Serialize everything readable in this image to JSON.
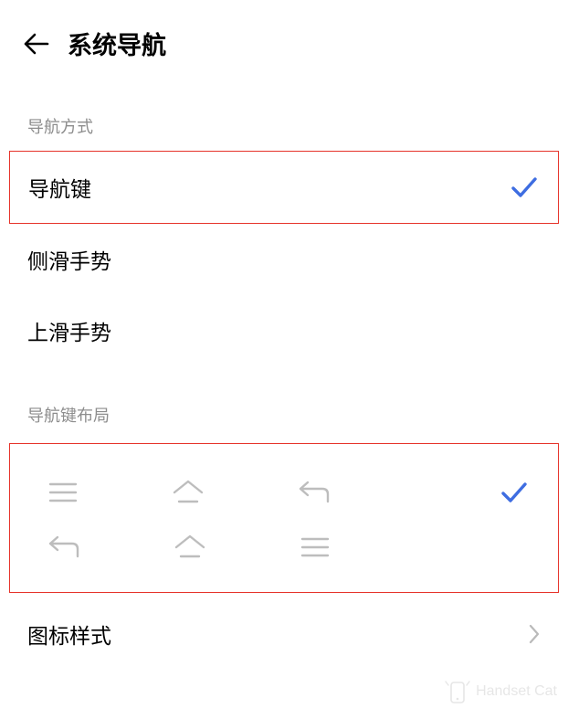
{
  "header": {
    "title": "系统导航"
  },
  "sections": {
    "nav_method_label": "导航方式",
    "nav_layout_label": "导航键布局"
  },
  "options": {
    "nav_keys": "导航键",
    "side_swipe": "侧滑手势",
    "up_swipe": "上滑手势"
  },
  "link": {
    "icon_style": "图标样式"
  },
  "colors": {
    "accent": "#3e6de1",
    "highlight_border": "#e6332a",
    "icon_gray": "#bdbdbd"
  },
  "watermark": {
    "text": "Handset Cat"
  }
}
